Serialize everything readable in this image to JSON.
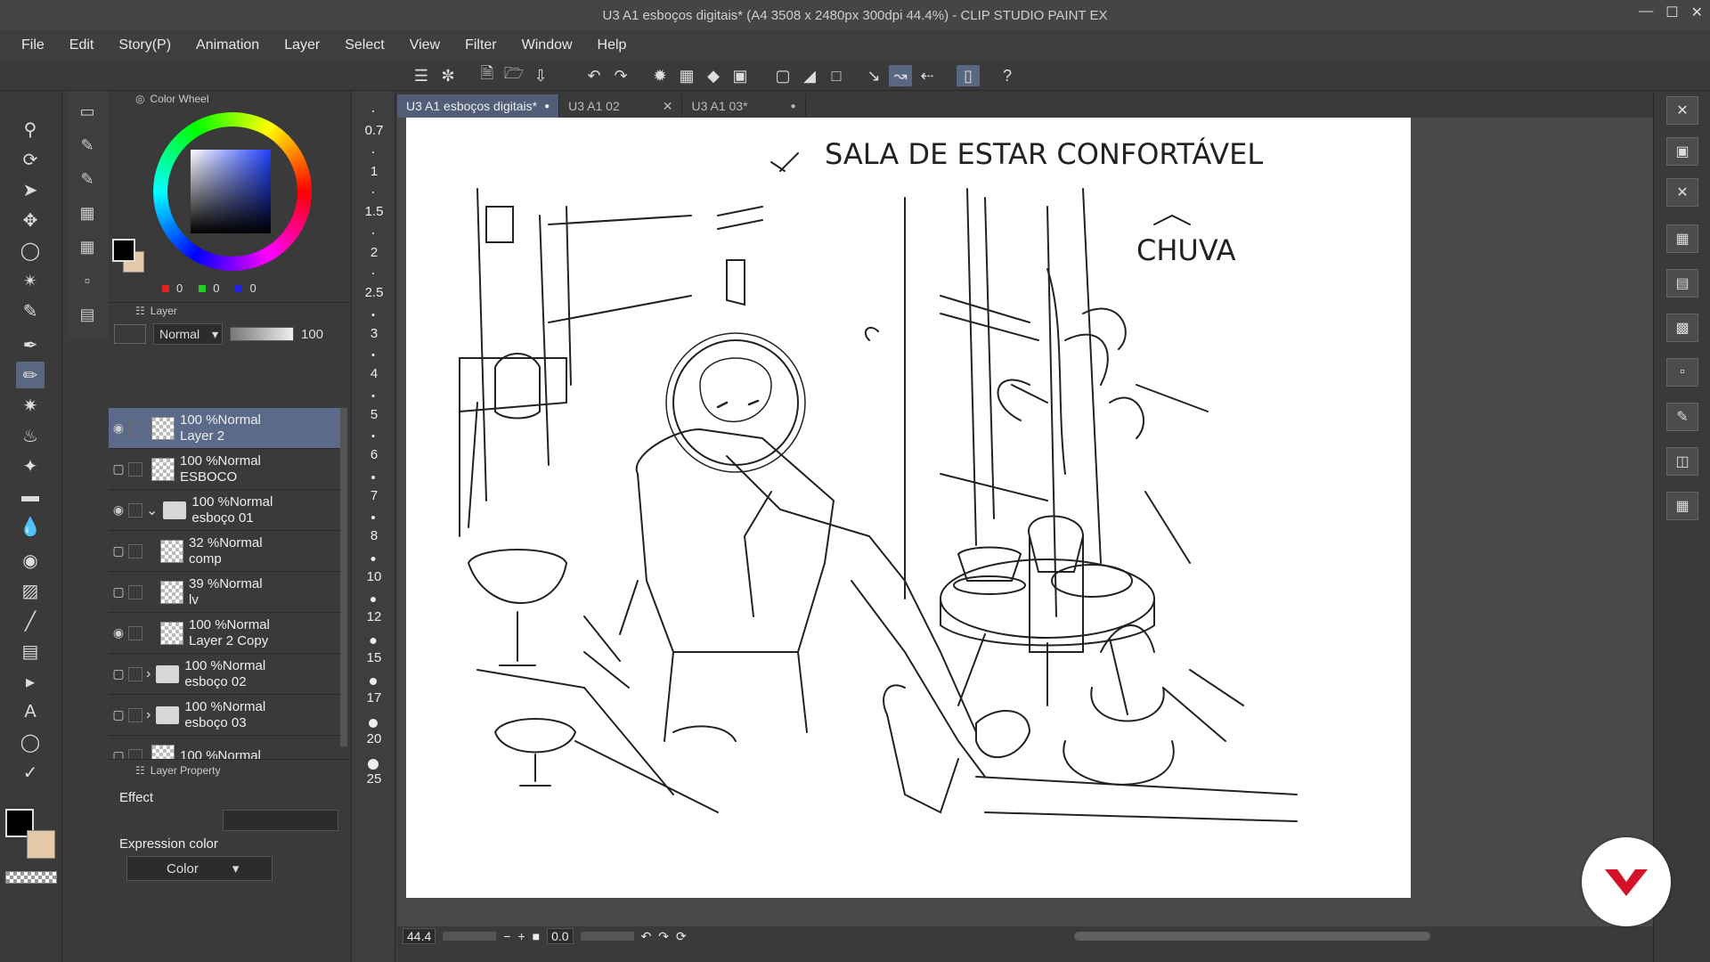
{
  "window": {
    "title": "U3 A1 esboços digitais* (A4 3508 x 2480px 300dpi 44.4%)  - CLIP STUDIO PAINT EX"
  },
  "menu": [
    "File",
    "Edit",
    "Story(P)",
    "Animation",
    "Layer",
    "Select",
    "View",
    "Filter",
    "Window",
    "Help"
  ],
  "color_panel": {
    "title": "Color Wheel",
    "r": "0",
    "g": "0",
    "b": "0",
    "main_color": "#000000",
    "sub_color": "#e4c8a8"
  },
  "layer_panel": {
    "title": "Layer",
    "blend_mode": "Normal",
    "opacity": "100",
    "layers": [
      {
        "line1": "100 %Normal",
        "line2": "Layer 2",
        "selected": true,
        "visible": true,
        "type": "raster",
        "indent": 0
      },
      {
        "line1": "100 %Normal",
        "line2": "ESBOCO",
        "selected": false,
        "visible": false,
        "type": "raster",
        "indent": 0
      },
      {
        "line1": "100 %Normal",
        "line2": "esboço 01",
        "selected": false,
        "visible": true,
        "type": "folder-open",
        "indent": 0
      },
      {
        "line1": "32 %Normal",
        "line2": "comp",
        "selected": false,
        "visible": false,
        "type": "raster",
        "indent": 1
      },
      {
        "line1": "39 %Normal",
        "line2": "lv",
        "selected": false,
        "visible": false,
        "type": "raster",
        "indent": 1
      },
      {
        "line1": "100 %Normal",
        "line2": "Layer 2 Copy",
        "selected": false,
        "visible": true,
        "type": "raster",
        "indent": 1
      },
      {
        "line1": "100 %Normal",
        "line2": "esboço 02",
        "selected": false,
        "visible": false,
        "type": "folder",
        "indent": 0
      },
      {
        "line1": "100 %Normal",
        "line2": "esboço 03",
        "selected": false,
        "visible": false,
        "type": "folder",
        "indent": 0
      },
      {
        "line1": "100 %Normal",
        "line2": "",
        "selected": false,
        "visible": false,
        "type": "raster",
        "indent": 0
      }
    ]
  },
  "layer_property": {
    "title": "Layer Property",
    "effect_label": "Effect",
    "expression_label": "Expression color",
    "expression_value": "Color"
  },
  "brush_sizes": [
    "0.7",
    "1",
    "1.5",
    "2",
    "2.5",
    "3",
    "4",
    "5",
    "6",
    "7",
    "8",
    "10",
    "12",
    "15",
    "17",
    "20",
    "25"
  ],
  "tabs": [
    {
      "label": "U3 A1 esboços digitais*",
      "active": true
    },
    {
      "label": "U3 A1 02",
      "active": false
    },
    {
      "label": "U3 A1 03*",
      "active": false
    }
  ],
  "canvas": {
    "caption_title": "SALA DE ESTAR CONFORTÁVEL",
    "caption_side": "CHUVA"
  },
  "status": {
    "zoom": "44.4",
    "angle": "0.0"
  }
}
